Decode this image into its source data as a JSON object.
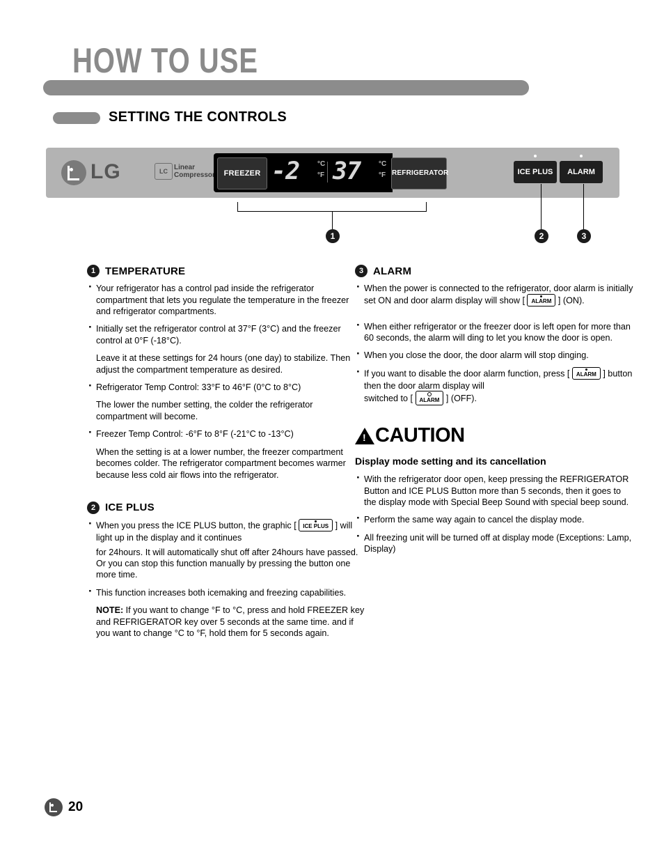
{
  "header": {
    "title": "HOW TO USE",
    "section_title": "SETTING THE CONTROLS"
  },
  "panel": {
    "brand": "LG",
    "linear_badge": "LC",
    "linear_text_line1": "Linear",
    "linear_text_line2": "Compressor",
    "freezer_button": "FREEZER",
    "refrigerator_button": "REFRIGERATOR",
    "freezer_value": "-2",
    "refrigerator_value": "37",
    "unit_c": "°C",
    "unit_f": "°F",
    "ice_plus_button": "ICE PLUS",
    "alarm_button": "ALARM",
    "callouts": [
      "1",
      "2",
      "3"
    ]
  },
  "sections": {
    "temperature": {
      "number": "1",
      "title": "TEMPERATURE",
      "bullets": [
        "Your refrigerator has a control pad inside the refrigerator compartment that lets you regulate the temperature in the freezer and refrigerator compartments.",
        "Initially set the refrigerator control at 37°F (3°C) and the freezer control at 0°F (-18°C).",
        "Refrigerator Temp Control: 33°F to 46°F (0°C to 8°C)",
        "Freezer Temp Control: -6°F to 8°F (-21°C to -13°C)"
      ],
      "note1": "Leave it at these settings for 24 hours (one day) to stabilize. Then adjust the compartment temperature as desired.",
      "note2": "The lower the number setting, the colder the refrigerator compartment will become.",
      "note3": "When the setting is at a lower number, the freezer compartment becomes colder. The refrigerator compartment becomes warmer because less cold air flows into the refrigerator."
    },
    "ice_plus": {
      "number": "2",
      "title": "ICE PLUS",
      "bullet1_a": "When you press the ICE PLUS button, the graphic [",
      "bullet1_key": "ICE PLUS",
      "bullet1_b": "] will light up in the display and it continues",
      "bullet1_cont": "for 24hours. It will automatically shut off after 24hours have passed. Or you can stop this function manually by pressing the button one more time.",
      "bullet2": "This function increases both icemaking and freezing capabilities.",
      "note_label": "NOTE:",
      "note_text": " If you want to change °F to °C, press and hold FREEZER key and REFRIGERATOR key over 5 seconds at the same time. and if you want to change °C to °F, hold them for 5 seconds again."
    },
    "alarm": {
      "number": "3",
      "title": "ALARM",
      "bullet1_a": "When the power is connected to the refrigerator, door alarm is initially set ON and door alarm display will show [",
      "bullet1_key": "ALARM",
      "bullet1_b": "] (ON).",
      "bullet2": "When either refrigerator or the freezer door is left open for more than 60 seconds, the alarm will ding to let you know the door is open.",
      "bullet3": "When you close the door, the door alarm will stop dinging.",
      "bullet4_a": "If you want to disable the door alarm function, press [",
      "bullet4_key": "ALARM",
      "bullet4_b": "] button then the door alarm display will",
      "bullet4_c": "switched to [",
      "bullet4_key2": "ALARM",
      "bullet4_d": "] (OFF)."
    },
    "caution": {
      "title": "CAUTION",
      "subtitle": "Display mode setting and its cancellation",
      "bullets": [
        "With the refrigerator door open, keep pressing the REFRIGERATOR Button and ICE PLUS Button more than 5 seconds, then it goes to the display mode with Special Beep Sound with special beep sound.",
        "Perform the same way again to cancel the display mode.",
        "All freezing unit will be turned off at display mode (Exceptions: Lamp, Display)"
      ]
    }
  },
  "footer": {
    "page_number": "20"
  }
}
